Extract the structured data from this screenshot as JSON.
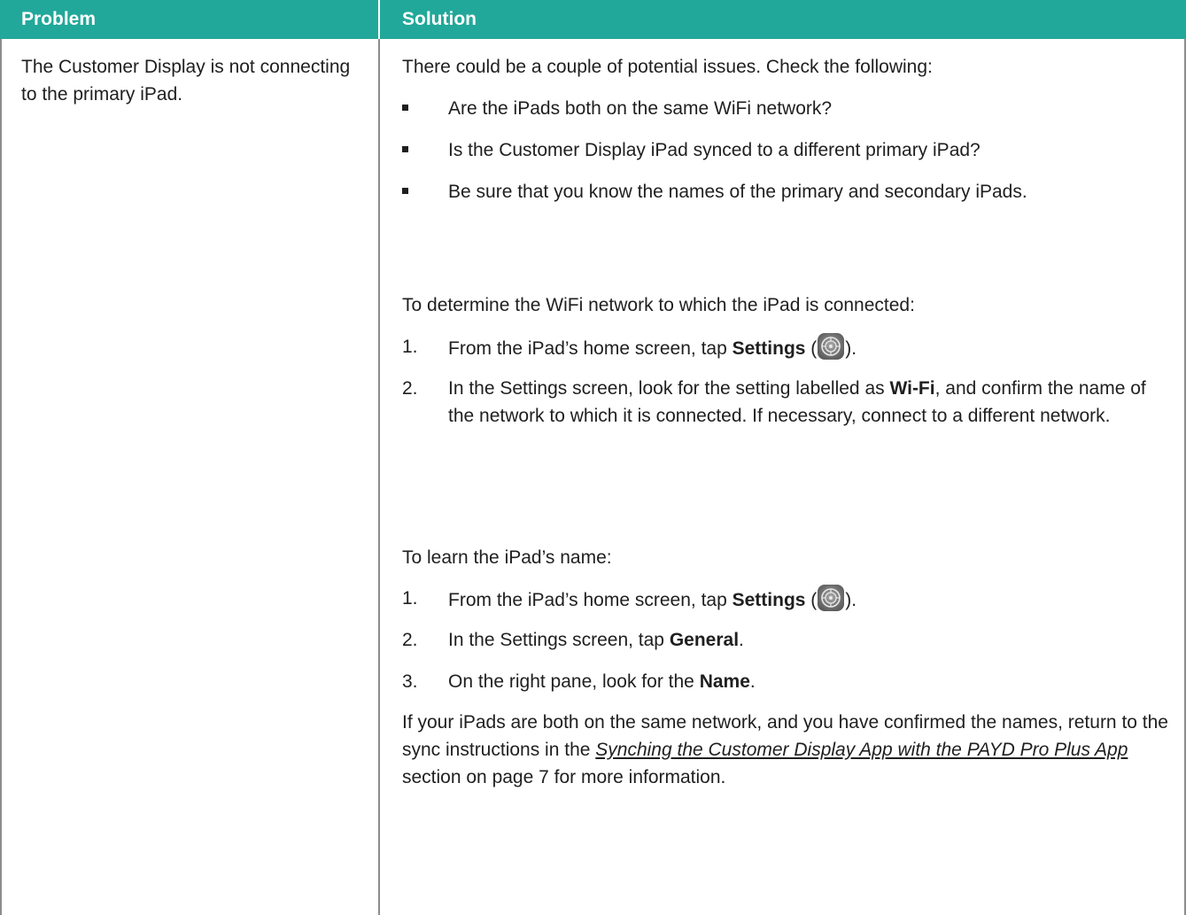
{
  "table": {
    "header": {
      "problem": "Problem",
      "solution": "Solution"
    },
    "problem_text": "The Customer Display is not connecting to the primary iPad.",
    "intro": "There could be a couple of potential issues. Check the following:",
    "bullets": [
      "Are the iPads both on the same WiFi network?",
      "Is the Customer Display iPad synced to a different primary iPad?",
      "Be sure that you know the names of the primary and secondary iPads."
    ],
    "wifi_intro": "To determine the WiFi network to which the iPad is connected:",
    "wifi_steps": [
      {
        "num": "1.",
        "pre": "From the iPad’s home screen, tap ",
        "bold": "Settings",
        "mid": " (",
        "post": ")."
      },
      {
        "num": "2.",
        "pre": "In the Settings screen, look for the setting labelled as ",
        "bold": "Wi-Fi",
        "post": ", and confirm the name of the network to which it is connected. If necessary, connect to a different network."
      }
    ],
    "name_intro": "To learn the iPad’s name:",
    "name_steps": [
      {
        "num": "1.",
        "pre": "From the iPad’s home screen, tap ",
        "bold": "Settings",
        "mid": " (",
        "post": ")."
      },
      {
        "num": "2.",
        "pre": "In the Settings screen, tap ",
        "bold": "General",
        "post": "."
      },
      {
        "num": "3.",
        "pre": "On the right pane, look for the ",
        "bold": "Name",
        "post": "."
      }
    ],
    "closing": {
      "pre": "If your iPads are both on the same network, and you have confirmed the names, return to the sync instructions in the ",
      "link": "Synching the Customer Display App with the PAYD Pro Plus App",
      "post": " section on page 7 for more information."
    }
  },
  "colors": {
    "header_bg": "#21a89a",
    "border": "#8c8c8c"
  },
  "icons": {
    "settings": "settings-gear-icon"
  }
}
